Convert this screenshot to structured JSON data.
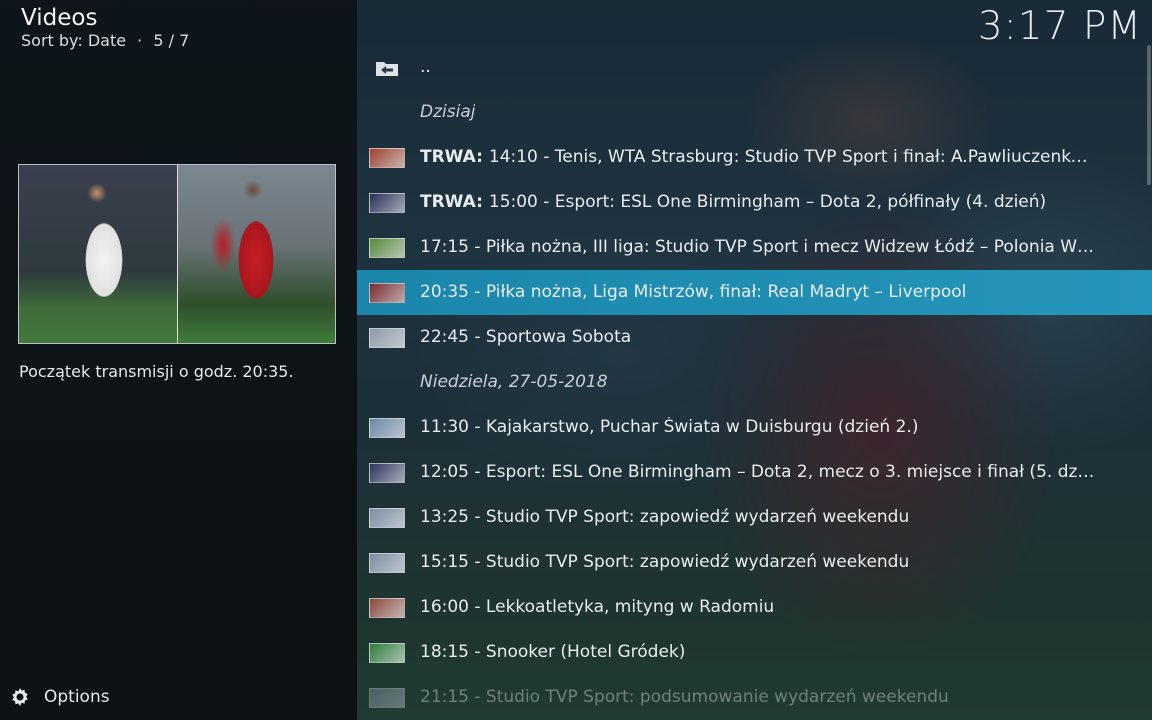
{
  "header": {
    "title": "Videos",
    "sort_label": "Sort by: Date",
    "separator": "·",
    "position": "5 / 7",
    "clock": "3:17 PM"
  },
  "info": {
    "plot": "Początek transmisji o godz. 20:35."
  },
  "footer": {
    "options_label": "Options"
  },
  "list": {
    "parent": "..",
    "section_today": "Dzisiaj",
    "section_sunday": "Niedziela, 27-05-2018",
    "live_prefix": "TRWA:",
    "items": [
      {
        "live": true,
        "label": "14:10 - Tenis, WTA Strasburg: Studio TVP Sport i finał: A.Pawliuczenko…",
        "thumb_color": "#a0432f"
      },
      {
        "live": true,
        "label": "15:00 - Esport: ESL One Birmingham – Dota 2, półfinały (4. dzień)",
        "thumb_color": "#2a2f56"
      },
      {
        "live": false,
        "label": "17:15 - Piłka nożna, III liga: Studio TVP Sport i mecz Widzew Łódź – Polonia W…",
        "thumb_color": "#5a8a3c"
      },
      {
        "live": false,
        "label": "20:35 - Piłka nożna, Liga Mistrzów, finał: Real Madryt – Liverpool",
        "thumb_color": "#7a2b2e"
      },
      {
        "live": false,
        "label": "22:45 - Sportowa Sobota",
        "thumb_color": "#8c9aa6"
      },
      {
        "live": false,
        "label": "11:30 - Kajakarstwo, Puchar Świata w Duisburgu (dzień 2.)",
        "thumb_color": "#6c88a4"
      },
      {
        "live": false,
        "label": "12:05 - Esport: ESL One Birmingham – Dota 2, mecz o 3. miejsce i finał (5. dzie…",
        "thumb_color": "#30345e"
      },
      {
        "live": false,
        "label": "13:25 - Studio TVP Sport: zapowiedź wydarzeń weekendu",
        "thumb_color": "#7b8ea0"
      },
      {
        "live": false,
        "label": "15:15 - Studio TVP Sport: zapowiedź wydarzeń weekendu",
        "thumb_color": "#7b8ea0"
      },
      {
        "live": false,
        "label": "16:00 - Lekkoatletyka, mityng w Radomiu",
        "thumb_color": "#8e4a3c"
      },
      {
        "live": false,
        "label": "18:15 - Snooker (Hotel Gródek)",
        "thumb_color": "#2f7d3a"
      },
      {
        "live": false,
        "label": "21:15 - Studio TVP Sport: podsumowanie wydarzeń weekendu",
        "thumb_color": "#7b8ea0"
      }
    ]
  },
  "colors": {
    "selection": "#1e8bb0",
    "background_left": "#0e1418"
  },
  "icons": {
    "parent_folder": "folder-back-icon",
    "options": "gear-icon"
  }
}
